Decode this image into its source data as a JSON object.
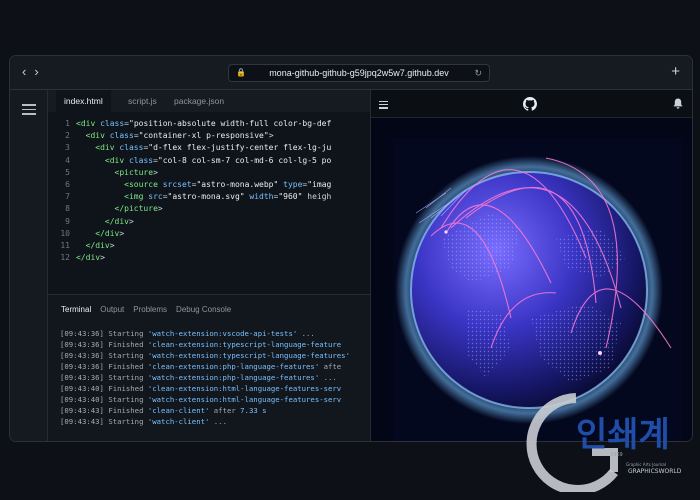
{
  "browser": {
    "url": "mona-github-github-g59jpq2w5w7.github.dev",
    "back_icon": "chevron-left-icon",
    "forward_icon": "chevron-right-icon",
    "new_tab_icon": "plus-icon"
  },
  "editor": {
    "tabs": [
      {
        "label": "index.html",
        "active": true
      },
      {
        "label": "script.js",
        "active": false
      },
      {
        "label": "package.json",
        "active": false
      }
    ],
    "lines": [
      {
        "n": "1",
        "text": "<div class=\"position-absolute width-full color-bg-def"
      },
      {
        "n": "2",
        "text": "  <div class=\"container-xl p-responsive\">"
      },
      {
        "n": "3",
        "text": "    <div class=\"d-flex flex-justify-center flex-lg-ju"
      },
      {
        "n": "4",
        "text": "      <div class=\"col-8 col-sm-7 col-md-6 col-lg-5 po"
      },
      {
        "n": "5",
        "text": "        <picture>"
      },
      {
        "n": "6",
        "text": "          <source srcset=\"astro-mona.webp\" type=\"imag"
      },
      {
        "n": "7",
        "text": "          <img src=\"astro-mona.svg\" width=\"960\" heigh"
      },
      {
        "n": "8",
        "text": "        </picture>"
      },
      {
        "n": "9",
        "text": "      </div>"
      },
      {
        "n": "10",
        "text": "    </div>"
      },
      {
        "n": "11",
        "text": "  </div>"
      },
      {
        "n": "12",
        "text": "</div>"
      }
    ]
  },
  "panel": {
    "tabs": [
      "Terminal",
      "Output",
      "Problems",
      "Debug Console"
    ],
    "active_tab": "Terminal",
    "lines": [
      {
        "time": "[09:43:36]",
        "verb": "Starting",
        "task": "'watch-extension:vscode-api-tests'",
        "tail": " ..."
      },
      {
        "time": "[09:43:36]",
        "verb": "Finished",
        "task": "'clean-extension:typescript-language-feature",
        "tail": ""
      },
      {
        "time": "[09:43:36]",
        "verb": "Starting",
        "task": "'watch-extension:typescript-language-features'",
        "tail": ""
      },
      {
        "time": "[09:43:36]",
        "verb": "Finished",
        "task": "'clean-extension:php-language-features'",
        "tail": " afte"
      },
      {
        "time": "[09:43:36]",
        "verb": "Starting",
        "task": "'watch-extension:php-language-features'",
        "tail": " ..."
      },
      {
        "time": "[09:43:40]",
        "verb": "Finished",
        "task": "'clean-extension:html-language-features-serv",
        "tail": ""
      },
      {
        "time": "[09:43:40]",
        "verb": "Starting",
        "task": "'watch-extension:html-language-features-serv",
        "tail": ""
      },
      {
        "time": "[09:43:43]",
        "verb": "Finished",
        "task": "'clean-client'",
        "tail": " after ",
        "num": "7.33 s"
      },
      {
        "time": "[09:43:43]",
        "verb": "Starting",
        "task": "'watch-client'",
        "tail": " ..."
      }
    ]
  },
  "preview": {
    "menu_icon": "hamburger-icon",
    "logo_icon": "github-logo-icon",
    "notification_icon": "bell-icon"
  },
  "watermark": {
    "text": "인쇄계",
    "year": "1969",
    "sub": "GRAPHICSWORLD",
    "tagline": "Graphic Arts Journal"
  },
  "colors": {
    "background": "#0d1117",
    "accent_blue": "#79c0ff",
    "accent_green": "#7ee787",
    "arc_pink": "#ff7bd5"
  }
}
